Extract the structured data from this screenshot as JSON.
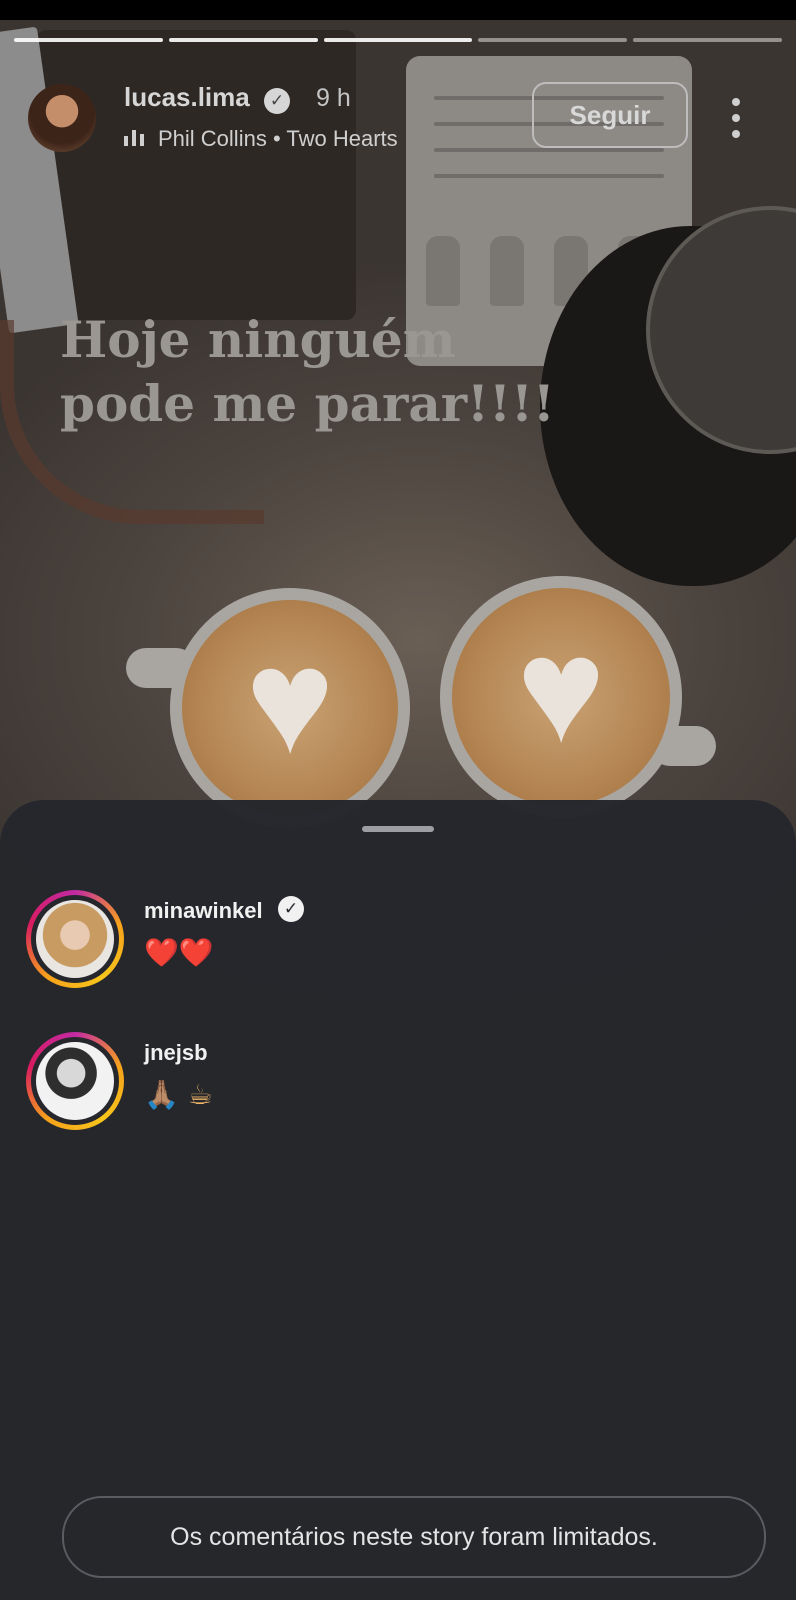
{
  "story": {
    "username": "lucas.lima",
    "verified": true,
    "time": "9 h",
    "music": {
      "artist": "Phil Collins",
      "separator": "•",
      "song": "Two Hearts"
    },
    "follow_label": "Seguir",
    "caption_line1": "Hoje ninguém",
    "caption_line2": "pode me parar!!!!",
    "progress_segments": 5
  },
  "icons": {
    "verified": "verified-badge-icon",
    "music": "music-bars-icon",
    "more": "more-vertical-icon",
    "verified_glyph": "✓"
  },
  "comments": [
    {
      "username": "minawinkel",
      "verified": true,
      "text": "❤️❤️"
    },
    {
      "username": "jnejsb",
      "verified": false,
      "text": "🙏🏽 ☕"
    }
  ],
  "footer": {
    "limited_message": "Os comentários neste story foram limitados."
  },
  "colors": {
    "sheet_bg": "#25272c",
    "ring_gradient": [
      "#c32aa3",
      "#f7a21b"
    ]
  }
}
